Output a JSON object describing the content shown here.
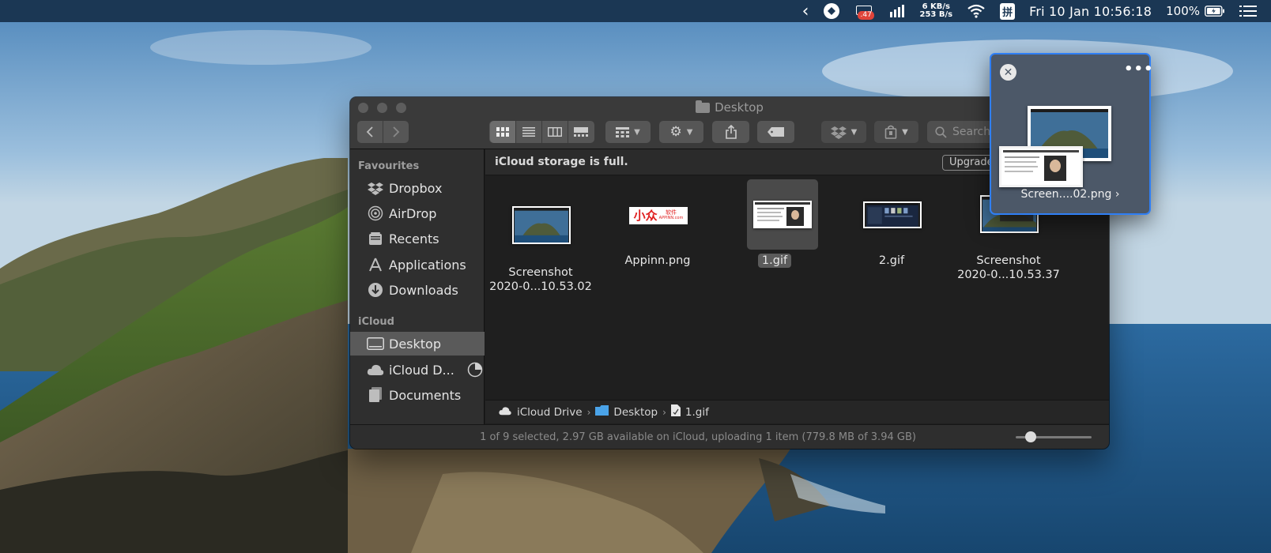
{
  "menubar": {
    "back_glyph": "‹",
    "badge_count": ".47",
    "net_up": "6 KB/s",
    "net_down": "253 B/s",
    "input_method": "拼",
    "clock": "Fri 10 Jan 10:56:18",
    "battery_percent": "100%"
  },
  "window": {
    "title": "Desktop",
    "search_placeholder": "Search"
  },
  "sidebar": {
    "favourites_title": "Favourites",
    "favourites": [
      {
        "label": "Dropbox",
        "icon": "dropbox-icon"
      },
      {
        "label": "AirDrop",
        "icon": "airdrop-icon"
      },
      {
        "label": "Recents",
        "icon": "recents-icon"
      },
      {
        "label": "Applications",
        "icon": "applications-icon"
      },
      {
        "label": "Downloads",
        "icon": "downloads-icon"
      }
    ],
    "icloud_title": "iCloud",
    "icloud": [
      {
        "label": "Desktop",
        "icon": "desktop-icon",
        "selected": true
      },
      {
        "label": "iCloud D...",
        "icon": "icloud-icon"
      },
      {
        "label": "Documents",
        "icon": "documents-icon"
      }
    ]
  },
  "banner": {
    "message": "iCloud storage is full.",
    "upgrade_label": "Upgrade"
  },
  "files": [
    {
      "line1": "Screenshot",
      "line2": "2020-0...10.53.02"
    },
    {
      "line1": "Appinn.png",
      "line2": ""
    },
    {
      "line1": "1.gif",
      "line2": "",
      "selected": true
    },
    {
      "line1": "2.gif",
      "line2": ""
    },
    {
      "line1": "Screenshot",
      "line2": "2020-0...10.53.37"
    }
  ],
  "thumbs": {
    "appinn_logo": "小众",
    "appinn_small": "软件",
    "appinn_url": "APPINN.com"
  },
  "pathbar": {
    "items": [
      "iCloud Drive",
      "Desktop",
      "1.gif"
    ],
    "sep": "›"
  },
  "status": {
    "text": "1 of 9 selected, 2.97 GB available on iCloud, uploading 1 item (779.8 MB of 3.94 GB)",
    "icon_size_level": 0.2
  },
  "floater": {
    "close_glyph": "✕",
    "more_glyph": "•••",
    "filename": "Screen....02.png ›"
  },
  "colors": {
    "menubar_bg": "#1b3754",
    "accent": "#2f7ff5",
    "finder_bg": "#1e1e1e"
  }
}
